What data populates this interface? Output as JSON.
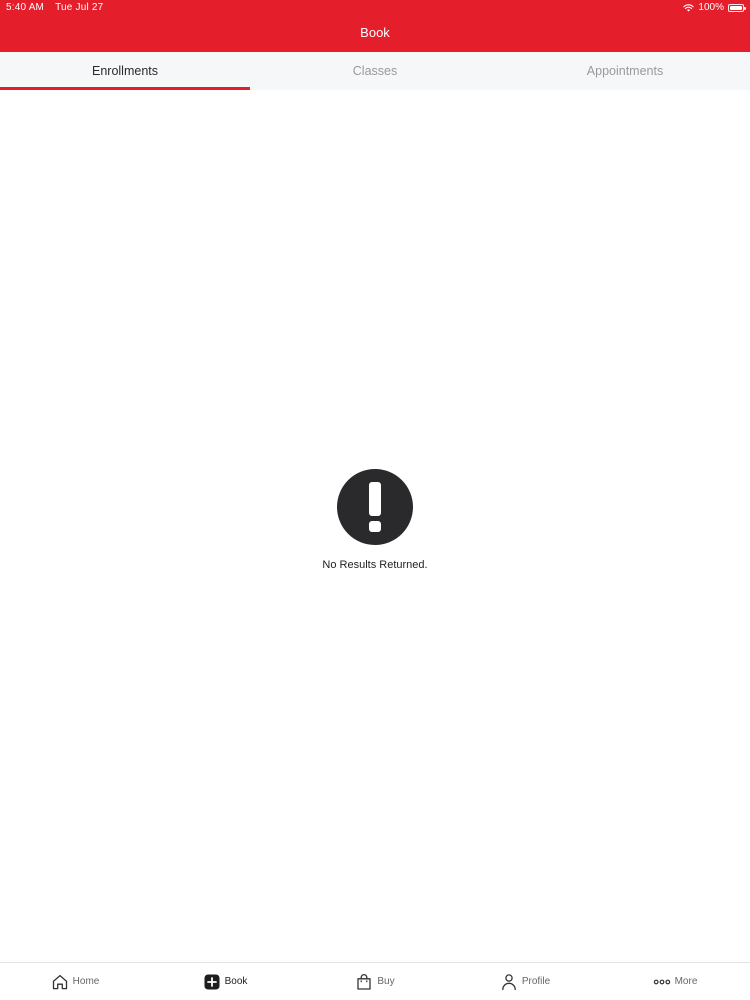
{
  "status_bar": {
    "time": "5:40 AM",
    "date": "Tue Jul 27",
    "battery": "100%"
  },
  "header": {
    "title": "Book",
    "background_color": "#e41e2b"
  },
  "tabs": [
    {
      "label": "Enrollments",
      "active": true
    },
    {
      "label": "Classes",
      "active": false
    },
    {
      "label": "Appointments",
      "active": false
    }
  ],
  "empty_state": {
    "icon": "exclamation-circle-icon",
    "message": "No Results Returned."
  },
  "bottom_nav": [
    {
      "label": "Home",
      "icon": "home-icon",
      "active": false
    },
    {
      "label": "Book",
      "icon": "plus-square-icon",
      "active": true
    },
    {
      "label": "Buy",
      "icon": "shopping-bag-icon",
      "active": false
    },
    {
      "label": "Profile",
      "icon": "person-icon",
      "active": false
    },
    {
      "label": "More",
      "icon": "ellipsis-icon",
      "active": false
    }
  ],
  "colors": {
    "accent": "#e41e2b",
    "tab_bar_bg": "#f6f7f9",
    "icon_dark": "#2a2a2d"
  }
}
